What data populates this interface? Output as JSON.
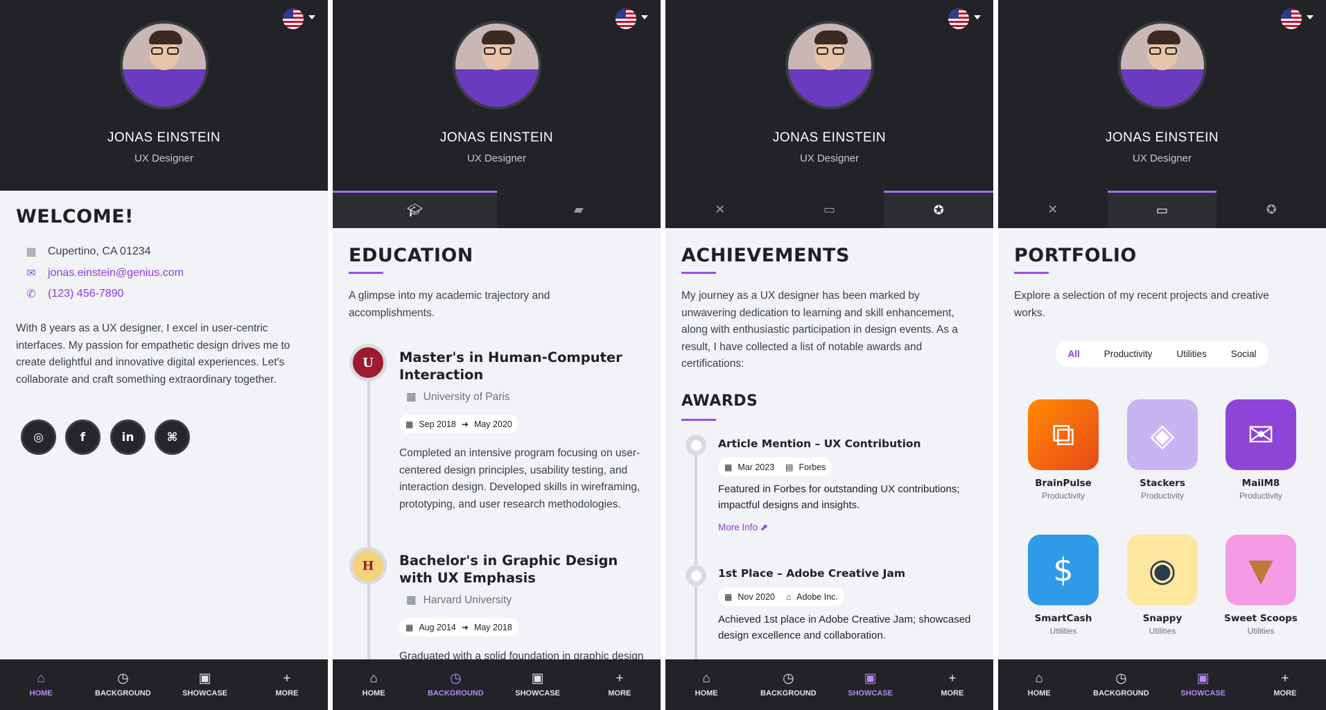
{
  "colors": {
    "accent": "#9b4fe6",
    "header_bg": "#222327",
    "page_bg": "#f1f3f6",
    "nav_active": "#b58af5"
  },
  "profile": {
    "name": "JONAS EINSTEIN",
    "role": "UX Designer",
    "language_flag": "us-flag-icon"
  },
  "nav": {
    "home": "HOME",
    "background": "BACKGROUND",
    "showcase": "SHOWCASE",
    "more": "MORE"
  },
  "home": {
    "title": "WELCOME!",
    "location": "Cupertino, CA 01234",
    "email": "jonas.einstein@genius.com",
    "phone": "(123) 456-7890",
    "bio": "With 8 years as a UX designer, I excel in user-centric interfaces. My passion for empathetic design drives me to create delightful and innovative digital experiences. Let's collaborate and craft something extraordinary together.",
    "social": [
      "instagram-icon",
      "facebook-icon",
      "linkedin-icon",
      "github-icon"
    ]
  },
  "background": {
    "title": "EDUCATION",
    "intro": "A glimpse into my academic trajectory and accomplishments.",
    "entries": [
      {
        "title": "Master's in Human-Computer Interaction",
        "school": "University of Paris",
        "start": "Sep 2018",
        "end": "May 2020",
        "desc": "Completed an intensive program focusing on user-centered design principles, usability testing, and interaction design. Developed skills in wireframing, prototyping, and user research methodologies."
      },
      {
        "title": "Bachelor's in Graphic Design with UX Emphasis",
        "school": "Harvard University",
        "start": "Aug 2014",
        "end": "May 2018",
        "desc": "Graduated with a solid foundation in graphic design"
      }
    ]
  },
  "achievements": {
    "title": "ACHIEVEMENTS",
    "intro": "My journey as a UX designer has been marked by unwavering dedication to learning and skill enhancement, along with enthusiastic participation in design events. As a result, I have collected a list of notable awards and certifications:",
    "awards_title": "AWARDS",
    "awards": [
      {
        "title": "Article Mention – UX Contribution",
        "date": "Mar 2023",
        "org": "Forbes",
        "desc": "Featured in Forbes for outstanding UX contributions; impactful designs and insights.",
        "link": "More Info"
      },
      {
        "title": "1st Place – Adobe Creative Jam",
        "date": "Nov 2020",
        "org": "Adobe Inc.",
        "desc": "Achieved 1st place in Adobe Creative Jam; showcased design excellence and collaboration."
      }
    ]
  },
  "portfolio": {
    "title": "PORTFOLIO",
    "intro": "Explore a selection of my recent projects and creative works.",
    "filters": [
      "All",
      "Productivity",
      "Utilities",
      "Social"
    ],
    "apps": [
      {
        "name": "BrainPulse",
        "category": "Productivity"
      },
      {
        "name": "Stackers",
        "category": "Productivity"
      },
      {
        "name": "MailM8",
        "category": "Productivity"
      },
      {
        "name": "SmartCash",
        "category": "Utilities"
      },
      {
        "name": "Snappy",
        "category": "Utilities"
      },
      {
        "name": "Sweet Scoops",
        "category": "Utilities"
      }
    ]
  }
}
